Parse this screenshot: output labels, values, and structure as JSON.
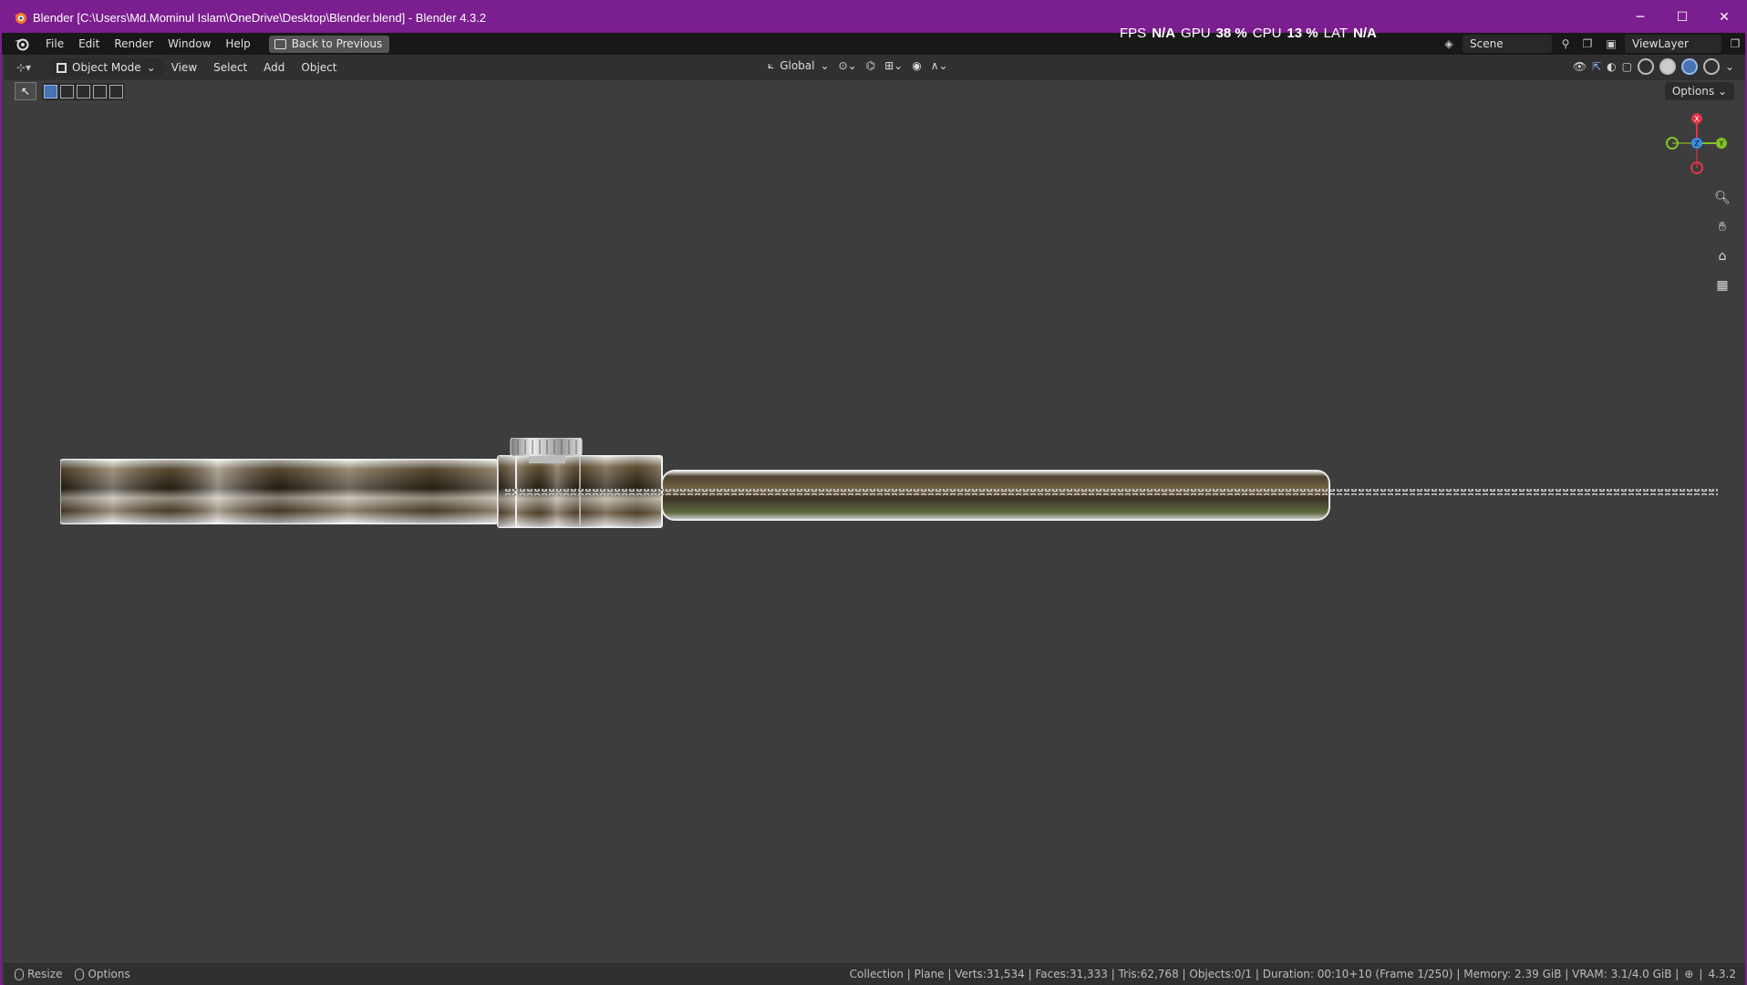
{
  "titlebar": {
    "title": "Blender [C:\\Users\\Md.Mominul Islam\\OneDrive\\Desktop\\Blender.blend] - Blender 4.3.2",
    "minimize": "─",
    "maximize": "☐",
    "close": "✕"
  },
  "perf": {
    "fps_label": "FPS",
    "fps_value": "N/A",
    "gpu_label": "GPU",
    "gpu_value": "38 %",
    "cpu_label": "CPU",
    "cpu_value": "13 %",
    "lat_label": "LAT",
    "lat_value": "N/A"
  },
  "menubar": {
    "items": [
      "File",
      "Edit",
      "Render",
      "Window",
      "Help"
    ],
    "back_button": "Back to Previous",
    "scene": "Scene",
    "view_layer": "ViewLayer"
  },
  "viewport_header": {
    "mode": "Object Mode",
    "menus": [
      "View",
      "Select",
      "Add",
      "Object"
    ],
    "orientation": "Global",
    "options": "Options"
  },
  "gizmo": {
    "x": "X",
    "y": "Y",
    "z": "Z"
  },
  "statusbar": {
    "resize": "Resize",
    "options": "Options",
    "info": "Collection | Plane | Verts:31,534 | Faces:31,333 | Tris:62,768 | Objects:0/1 | Duration: 00:10+10 (Frame 1/250) | Memory: 2.39 GiB | VRAM: 3.1/4.0 GiB |",
    "version": "4.3.2"
  },
  "colors": {
    "titlebar": "#7b1e8f",
    "viewport_bg": "#3d3d3d",
    "accent": "#4772b3",
    "axis_x": "#e0344b",
    "axis_y": "#84c225",
    "axis_z": "#3a8ee6"
  }
}
